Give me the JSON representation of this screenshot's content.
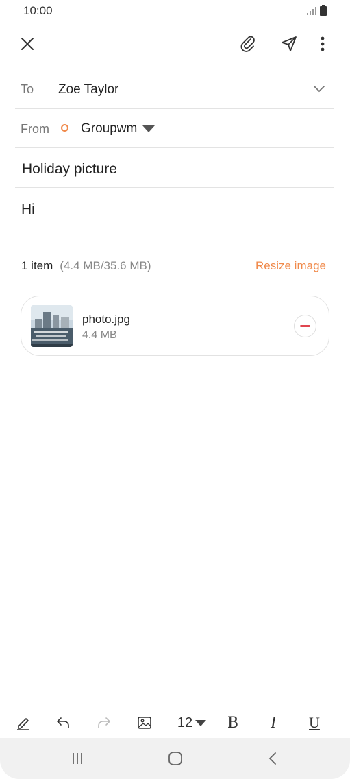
{
  "status": {
    "time": "10:00",
    "icons": [
      "signal-icon",
      "battery-icon"
    ]
  },
  "toolbar": {
    "close": "close-icon",
    "attach": "paperclip-icon",
    "send": "send-icon",
    "more": "more-vertical-icon"
  },
  "compose": {
    "to_label": "To",
    "to_value": "Zoe Taylor",
    "from_label": "From",
    "from_value": "Groupwm",
    "subject": "Holiday picture",
    "body": "Hi"
  },
  "attachments": {
    "count_label": "1 item",
    "size_label": "(4.4 MB/35.6 MB)",
    "resize_label": "Resize image",
    "items": [
      {
        "name": "photo.jpg",
        "size": "4.4 MB"
      }
    ]
  },
  "format_bar": {
    "font_size": "12",
    "bold": "B",
    "italic": "I",
    "underline": "U"
  },
  "colors": {
    "accent": "#f08a4b",
    "remove": "#e0454f"
  }
}
